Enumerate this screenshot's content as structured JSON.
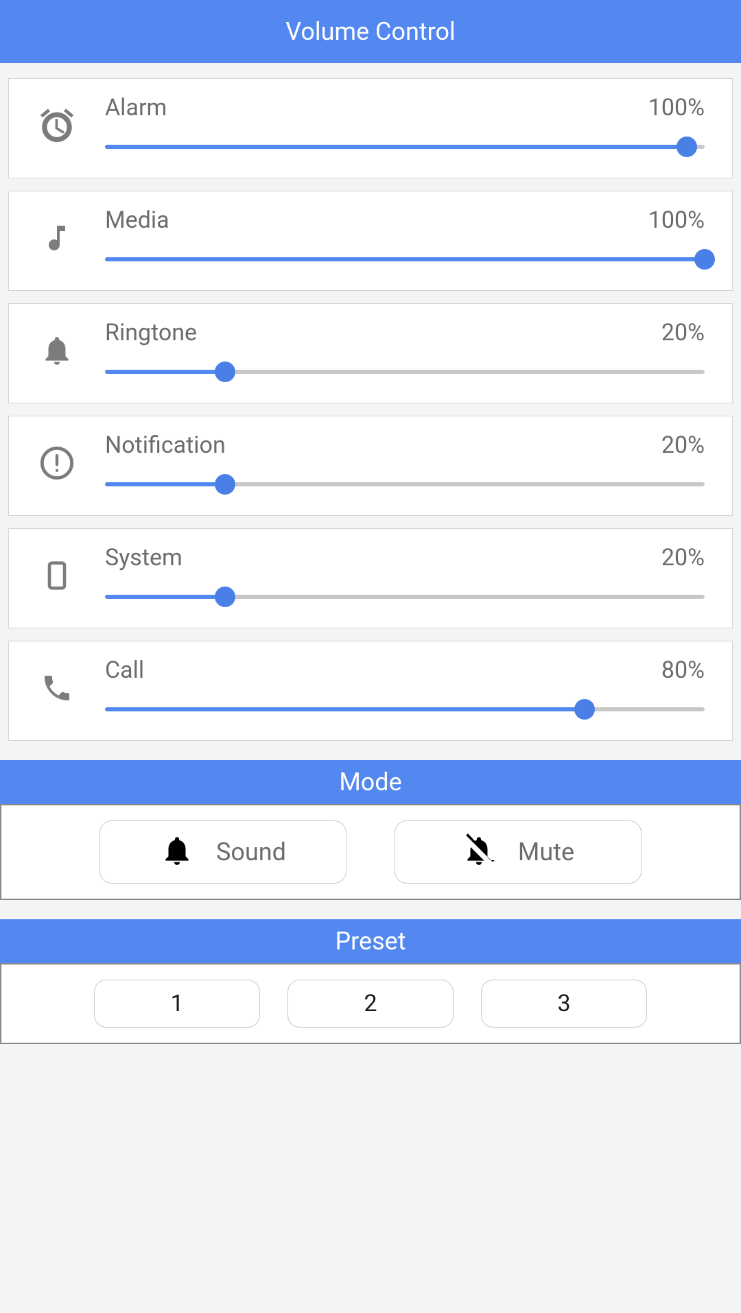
{
  "header": {
    "title": "Volume Control"
  },
  "volumes": [
    {
      "icon": "alarm",
      "label": "Alarm",
      "value": 100,
      "display": "100%"
    },
    {
      "icon": "music",
      "label": "Media",
      "value": 100,
      "display": "100%"
    },
    {
      "icon": "bell",
      "label": "Ringtone",
      "value": 20,
      "display": "20%"
    },
    {
      "icon": "alert",
      "label": "Notification",
      "value": 20,
      "display": "20%"
    },
    {
      "icon": "phone",
      "label": "System",
      "value": 20,
      "display": "20%"
    },
    {
      "icon": "call",
      "label": "Call",
      "value": 80,
      "display": "80%"
    }
  ],
  "mode": {
    "header": "Mode",
    "buttons": [
      {
        "icon": "bell-solid",
        "label": "Sound"
      },
      {
        "icon": "bell-off",
        "label": "Mute"
      }
    ]
  },
  "preset": {
    "header": "Preset",
    "buttons": [
      "1",
      "2",
      "3"
    ]
  }
}
